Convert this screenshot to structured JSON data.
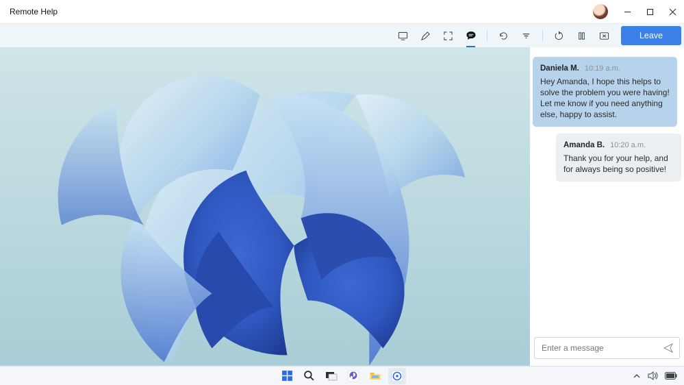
{
  "window": {
    "title": "Remote Help"
  },
  "toolbar": {
    "leave_label": "Leave"
  },
  "chat": {
    "placeholder": "Enter a message",
    "messages": [
      {
        "name": "Daniela M.",
        "time": "10:19 a.m.",
        "body": "Hey Amanda, I hope this helps to solve the problem you were having! Let me know if you need anything else, happy to assist."
      },
      {
        "name": "Amanda B.",
        "time": "10:20 a.m.",
        "body": "Thank you for your help, and for always being so positive!"
      }
    ]
  }
}
